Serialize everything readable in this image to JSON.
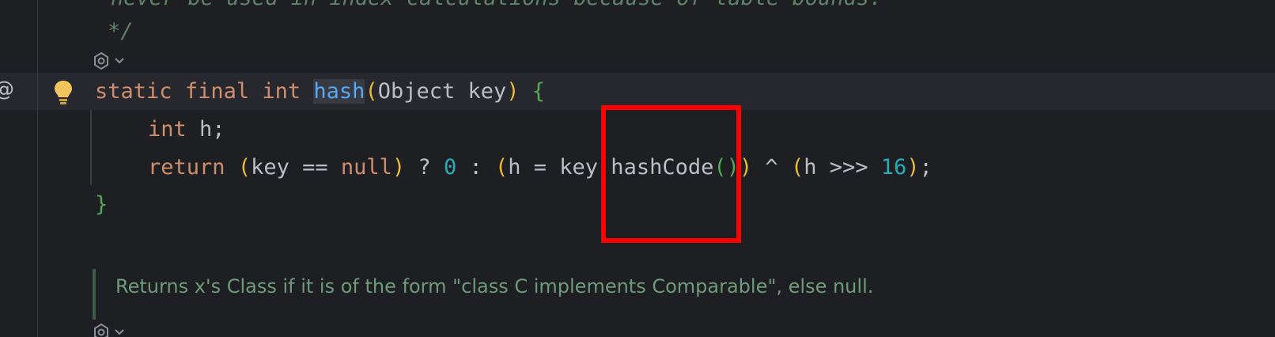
{
  "editor": {
    "comment_partial": "never be used in index calculations because of table bounds.",
    "comment_end": "*/",
    "line_method": {
      "kw_static": "static",
      "kw_final": "final",
      "kw_int": "int",
      "name": "hash",
      "paren_open": "(",
      "params": "Object key",
      "paren_close": ")",
      "brace_open": "{"
    },
    "line_decl": {
      "kw_int": "int",
      "rest": " h;"
    },
    "line_return": {
      "kw_return": "return",
      "p_open1": "(",
      "key_eq": "key == ",
      "kw_null": "null",
      "p_close1": ")",
      "ternary": " ? ",
      "zero": "0",
      "colon": " : ",
      "p_open2": "(",
      "assign": "h = key.hashCode",
      "call_open": "(",
      "call_close": ")",
      "p_close2": ")",
      "xor": " ^ ",
      "p_open3": "(",
      "shift": "h >>> ",
      "sixteen": "16",
      "p_close3": ")",
      "semi": ";"
    },
    "brace_close": "}",
    "doc_comment": "Returns x's Class if it is of the form \"class C implements Comparable\", else null."
  },
  "gutter": {
    "at_symbol": "@",
    "bulb_icon": "lightbulb-icon",
    "gear_icon": "ai-assistant-icon",
    "chevron_icon": "chevron-down-icon"
  },
  "colors": {
    "background": "#1e1f22",
    "keyword": "#cf8e6d",
    "function": "#56a8f5",
    "number": "#2aacb8",
    "comment": "#5f826b",
    "highlight_box": "#ff0000"
  }
}
